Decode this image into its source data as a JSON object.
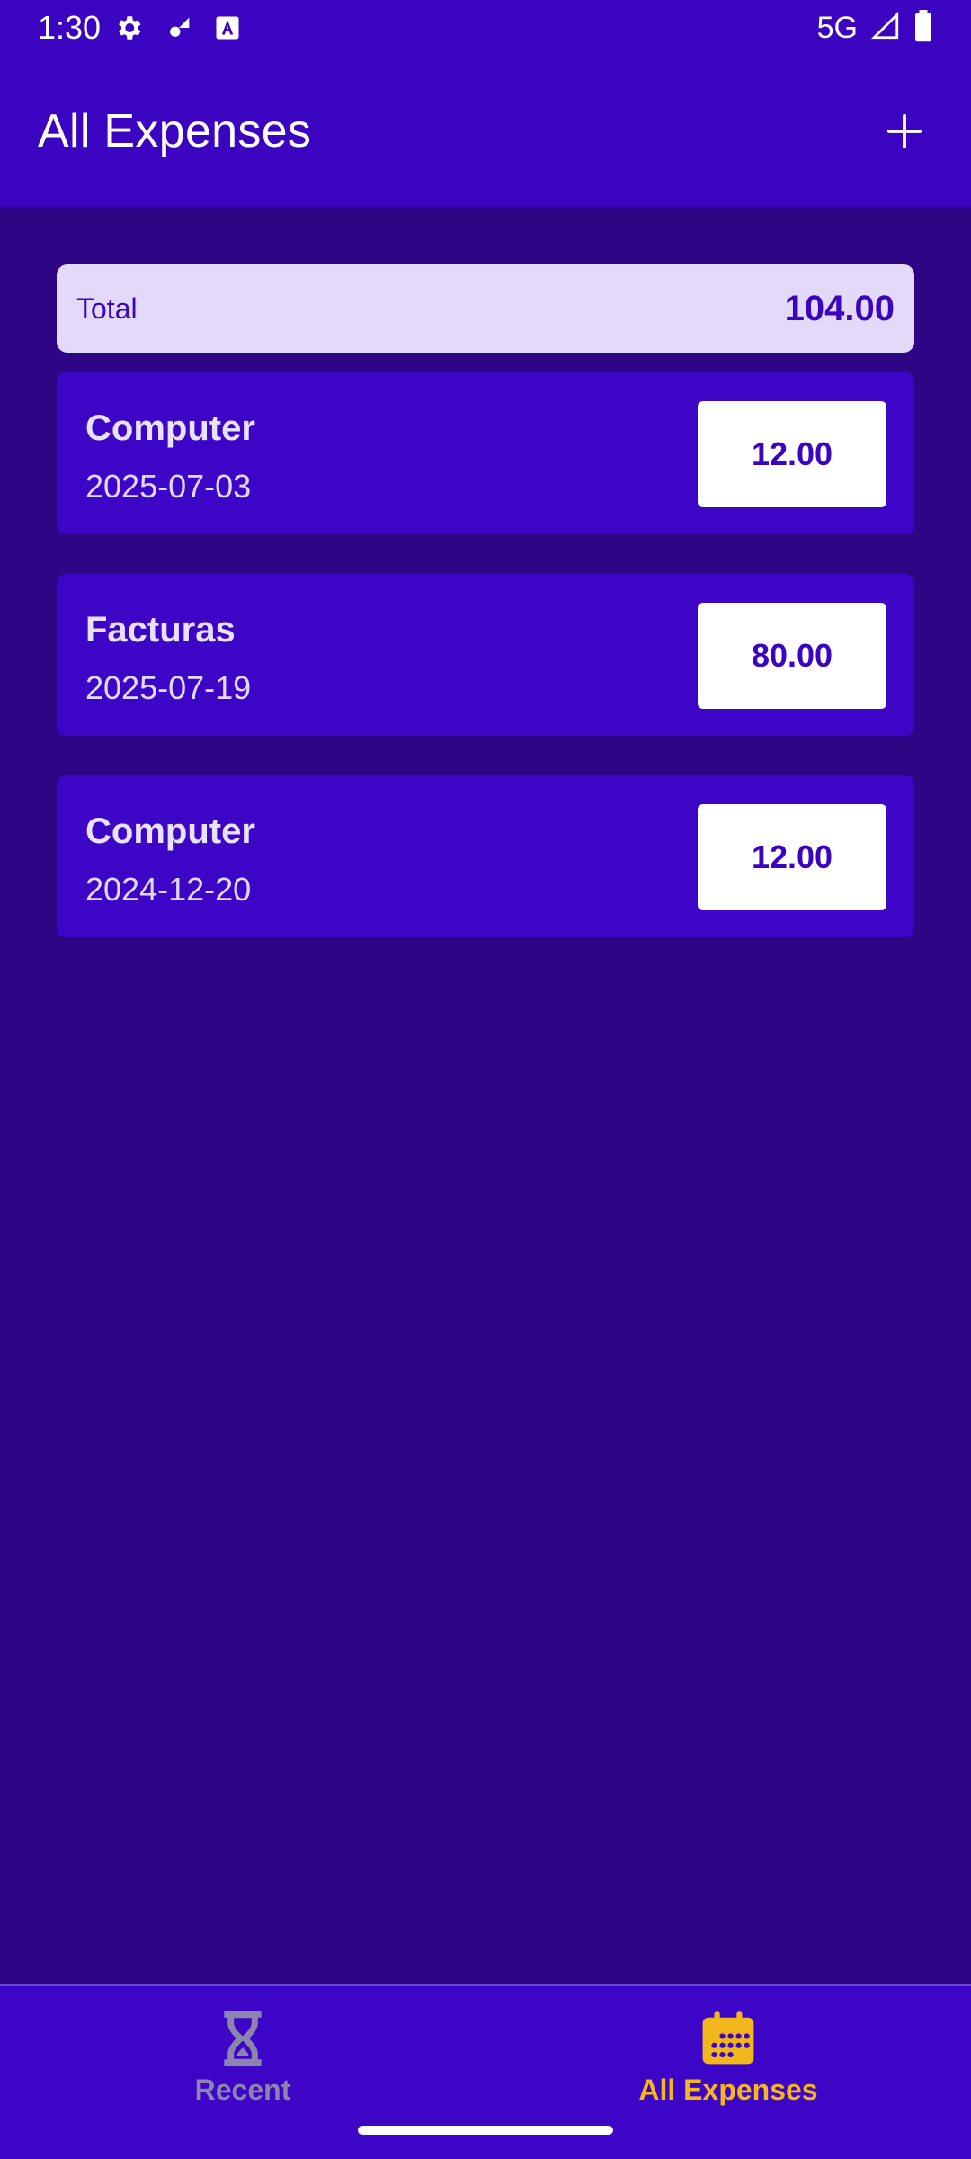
{
  "status_bar": {
    "time": "1:30",
    "network": "5G",
    "icons": [
      "settings-icon",
      "fan-icon",
      "font-download-icon",
      "signal-icon",
      "battery-icon"
    ]
  },
  "app_bar": {
    "title": "All Expenses",
    "add_icon": "plus-icon"
  },
  "summary": {
    "label": "Total",
    "value": "104.00"
  },
  "expenses": [
    {
      "name": "Computer",
      "date": "2025-07-03",
      "amount": "12.00"
    },
    {
      "name": "Facturas",
      "date": "2025-07-19",
      "amount": "80.00"
    },
    {
      "name": "Computer",
      "date": "2024-12-20",
      "amount": "12.00"
    }
  ],
  "bottom_nav": {
    "items": [
      {
        "label": "Recent",
        "icon": "hourglass-icon",
        "active": false
      },
      {
        "label": "All Expenses",
        "icon": "calendar-icon",
        "active": true
      }
    ]
  },
  "colors": {
    "background": "#2d0585",
    "primary": "#3b04c1",
    "card": "#3d05c6",
    "total_card": "#e3dafa",
    "active_accent": "#f2b71d",
    "inactive": "#8c84ad"
  }
}
